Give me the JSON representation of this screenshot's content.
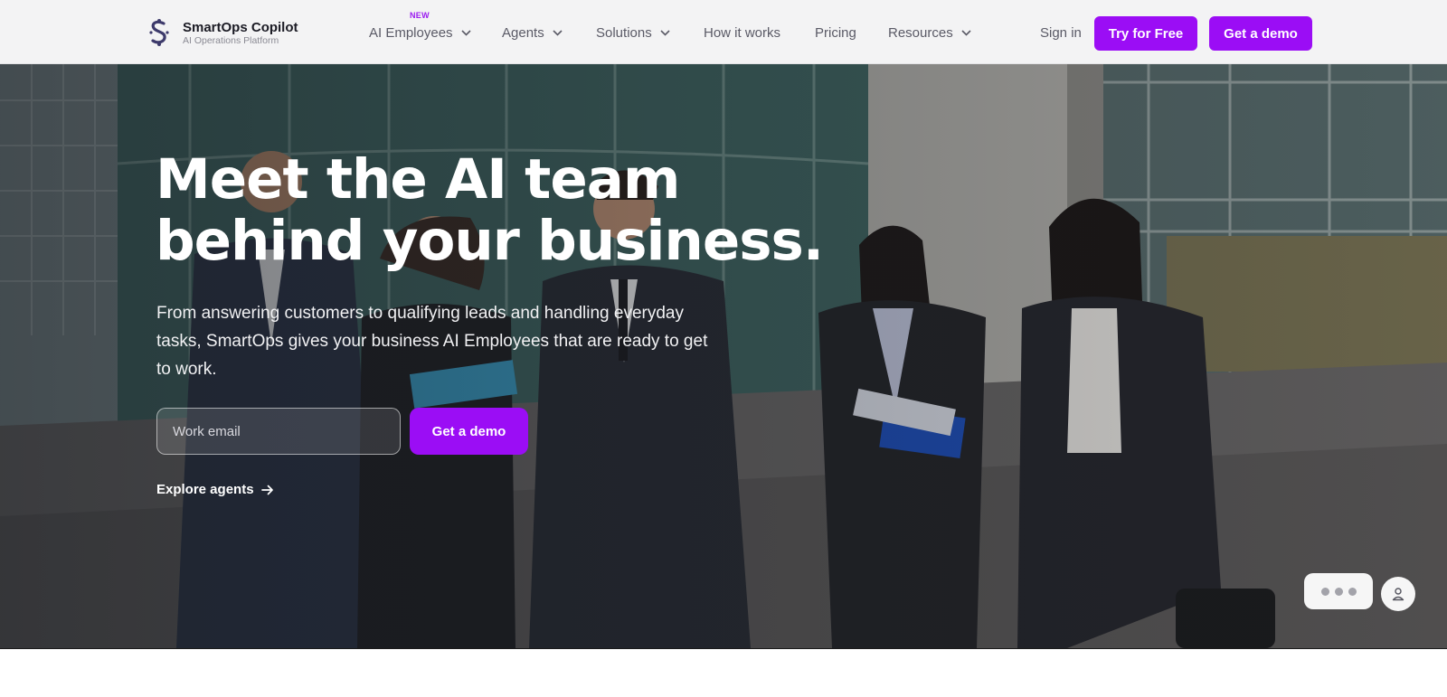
{
  "brand": {
    "name": "SmartOps Copilot",
    "tagline": "AI Operations Platform",
    "logo_icon": "smartops-logo-icon",
    "accent_color": "#9b0df5"
  },
  "nav": {
    "items": [
      {
        "label": "AI Employees",
        "badge": "NEW",
        "dropdown": true
      },
      {
        "label": "Agents",
        "dropdown": true
      },
      {
        "label": "Solutions",
        "dropdown": true
      },
      {
        "label": "How it works",
        "dropdown": false
      },
      {
        "label": "Pricing",
        "dropdown": false
      },
      {
        "label": "Resources",
        "dropdown": true
      }
    ],
    "sign_in": "Sign in",
    "try_free": "Try for Free",
    "get_demo": "Get a demo"
  },
  "hero": {
    "headline_line1": "Meet the AI team",
    "headline_line2": "behind your business.",
    "subtext": "From answering customers to qualifying leads and handling everyday tasks, SmartOps gives your business AI Employees that are ready to get to work.",
    "email_placeholder": "Work email",
    "cta": "Get a demo",
    "explore": "Explore agents",
    "background_image": "group of business people walking outside an office building"
  },
  "widgets": {
    "chat_icon": "ellipsis-chat-icon",
    "avatar_icon": "user-icon"
  }
}
